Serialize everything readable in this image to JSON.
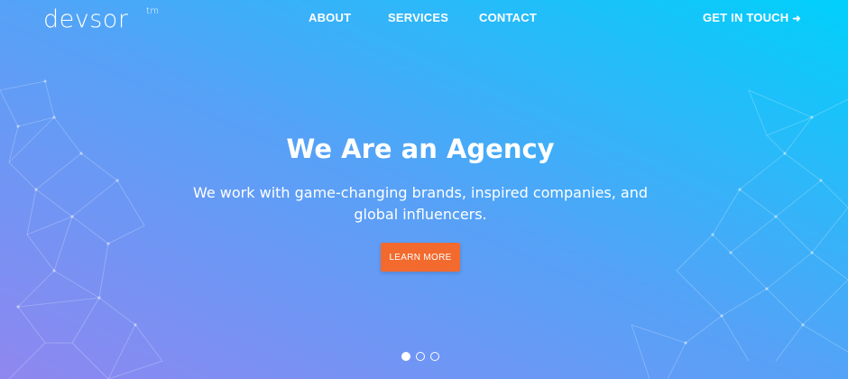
{
  "colors": {
    "gradient_start": "#8f87f0",
    "gradient_mid": "#55a2f7",
    "gradient_end": "#00d0fb",
    "button": "#f26a2e",
    "text": "#ffffff"
  },
  "header": {
    "logo_text": "devsor",
    "logo_mark": "tm",
    "nav": [
      {
        "label": "ABOUT"
      },
      {
        "label": "SERVICES"
      },
      {
        "label": "CONTACT"
      }
    ],
    "cta_label": "GET IN TOUCH",
    "cta_icon": "arrow-right-icon"
  },
  "hero": {
    "title": "We Are an Agency",
    "subtitle_line1": "We work with game-changing brands, inspired companies, and",
    "subtitle_line2": "global influencers.",
    "button_label": "LEARN MORE"
  },
  "slider": {
    "slide_count": 3,
    "active_slide": 1
  }
}
